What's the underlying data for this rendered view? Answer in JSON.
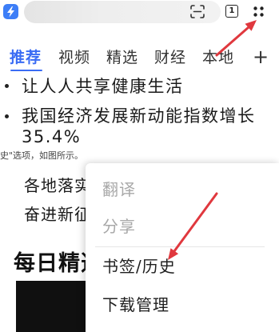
{
  "colors": {
    "accent": "#3a6cf4",
    "logo": "#3d7ef7",
    "text": "#1f1f1f",
    "muted": "#a8a8a8",
    "annotation_arrow": "#e0383e"
  },
  "top_bar": {
    "logo_icon": "app-logo-icon",
    "scan_icon": "scan-icon",
    "tab_count": "1",
    "more_icon": "grid-dots-icon"
  },
  "channels": {
    "tabs": [
      {
        "label": "推荐",
        "active": true
      },
      {
        "label": "视频",
        "active": false
      },
      {
        "label": "精选",
        "active": false
      },
      {
        "label": "财经",
        "active": false
      },
      {
        "label": "本地",
        "active": false
      }
    ],
    "add_label": "+"
  },
  "feed": {
    "bullet_1": "让人人共享健康生活",
    "bullet_2_line_1": "我国经济发展新动能指数增长",
    "bullet_2_line_2": "35.4%",
    "caption": "史\"选项，如图所示。",
    "news_1": "各地落实",
    "news_2": "奋进新征",
    "section_title": "每日精选"
  },
  "menu": {
    "items": [
      {
        "label": "翻译",
        "disabled": true
      },
      {
        "label": "分享",
        "disabled": true
      },
      {
        "label": "书签/历史",
        "disabled": false
      },
      {
        "label": "下载管理",
        "disabled": false
      }
    ]
  }
}
